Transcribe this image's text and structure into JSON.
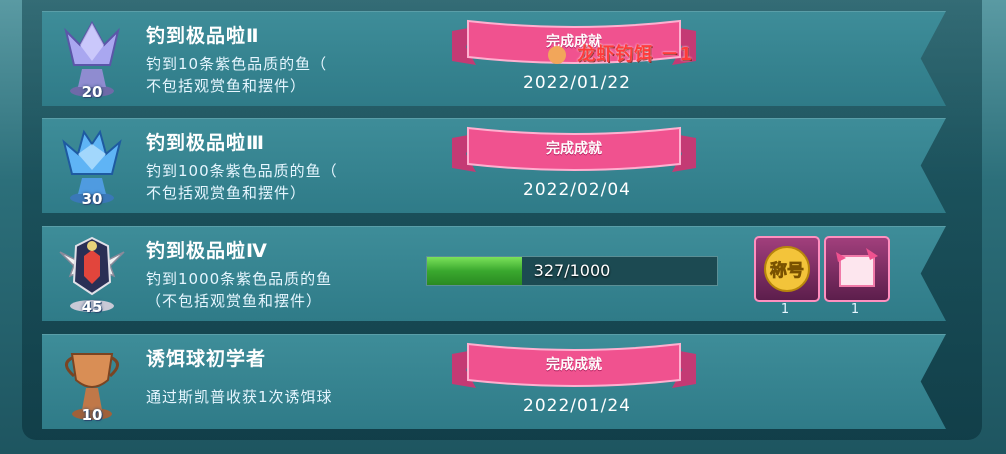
{
  "achievements": [
    {
      "title": "钓到极品啦Ⅱ",
      "desc_line1": "钓到10条紫色品质的鱼（",
      "desc_line2": "不包括观赏鱼和摆件）",
      "level": "20",
      "badge_icon": "purple-crystal-trophy-icon",
      "status_label": "完成成就",
      "date": "2022/01/22"
    },
    {
      "title": "钓到极品啦Ⅲ",
      "desc_line1": "钓到100条紫色品质的鱼（",
      "desc_line2": "不包括观赏鱼和摆件）",
      "level": "30",
      "badge_icon": "blue-crystal-trophy-icon",
      "status_label": "完成成就",
      "date": "2022/02/04"
    },
    {
      "title": "钓到极品啦Ⅳ",
      "desc_line1": "钓到1000条紫色品质的鱼",
      "desc_line2": "（不包括观赏鱼和摆件）",
      "level": "45",
      "badge_icon": "winged-dark-crystal-trophy-icon",
      "progress_text": "327/1000",
      "progress_fraction": 0.327,
      "rewards": [
        {
          "icon": "title-coin-icon",
          "label": "称号",
          "count": "1"
        },
        {
          "icon": "pink-frame-icon",
          "count": "1"
        }
      ]
    },
    {
      "title": "诱饵球初学者",
      "desc_line1": "通过斯凯普收获1次诱饵球",
      "level": "10",
      "badge_icon": "bronze-trophy-icon",
      "status_label": "完成成就",
      "date": "2022/01/24"
    }
  ],
  "floating_message": "龙虾钓饵 －1",
  "colors": {
    "ribbon": "#f0528f",
    "progress_fill": "#4cc23a",
    "message": "#ff3b3b"
  }
}
